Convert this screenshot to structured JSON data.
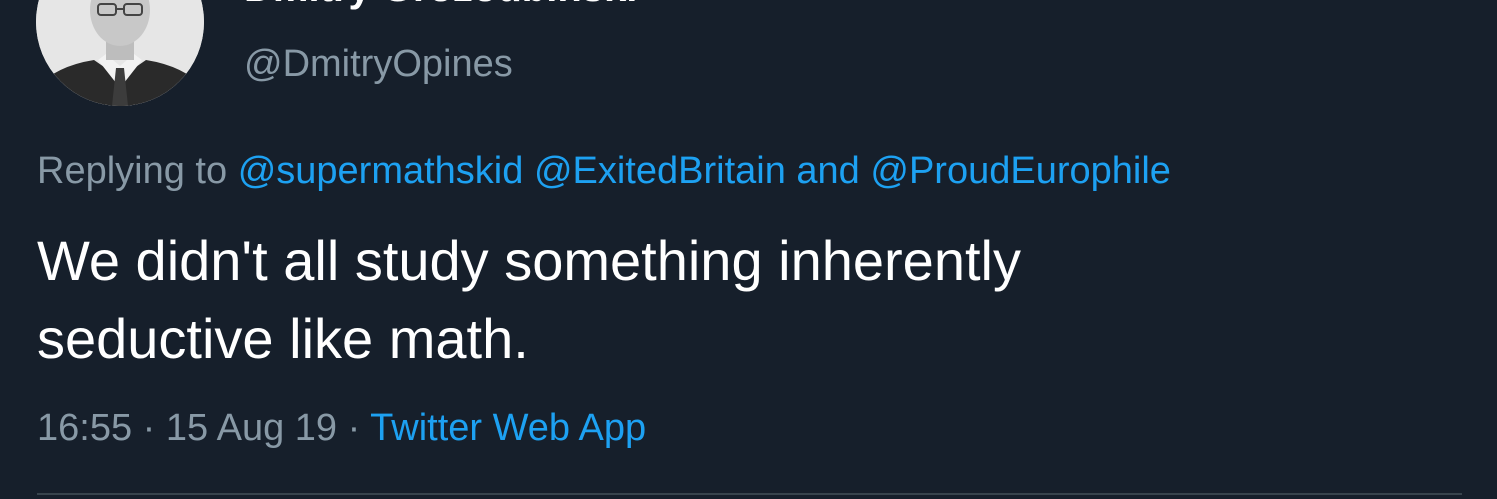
{
  "author": {
    "display_name": "Dmitry Grozoubinski",
    "handle": "@DmitryOpines",
    "avatar_icon": "profile-photo"
  },
  "reply": {
    "prefix": "Replying to",
    "mentions": [
      "@supermathskid",
      "@ExitedBritain"
    ],
    "conjunction": "and",
    "last_mention": "@ProudEurophile"
  },
  "tweet": {
    "line1": "We didn't all study something inherently",
    "line2": "seductive like math."
  },
  "meta": {
    "time": "16:55",
    "separator": "·",
    "date": "15 Aug 19",
    "source": "Twitter Web App"
  },
  "colors": {
    "background": "#161f2b",
    "text": "#ffffff",
    "secondary": "#8899a6",
    "link": "#1da1f2",
    "divider": "#38444d"
  }
}
